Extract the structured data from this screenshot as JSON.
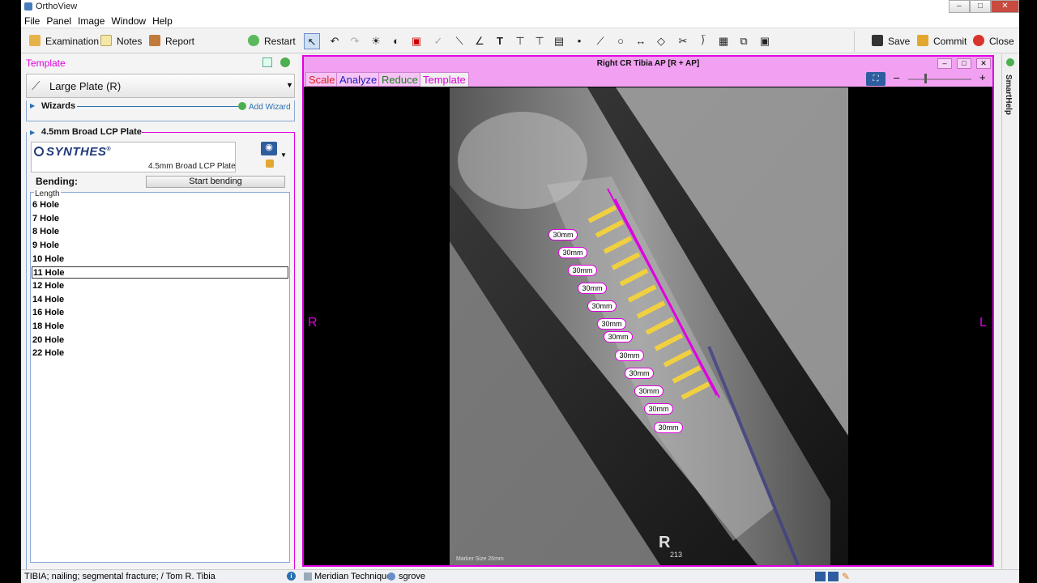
{
  "app_title": "OrthoView",
  "menu": [
    "File",
    "Panel",
    "Image",
    "Window",
    "Help"
  ],
  "toolbar": {
    "examination": "Examination",
    "notes": "Notes",
    "report": "Report",
    "restart": "Restart",
    "save": "Save",
    "commit": "Commit",
    "close": "Close"
  },
  "left_panel": {
    "header": "Template",
    "plate_selector": "Large Plate (R)",
    "wizards_label": "Wizards",
    "add_wizard": "Add Wizard",
    "plate_section": "4.5mm Broad LCP Plate",
    "brand": "SYNTHES",
    "brand_mark": "®",
    "plate_name": "4.5mm Broad LCP Plate",
    "bending_label": "Bending:",
    "start_bending": "Start bending",
    "length_label": "Length",
    "lengths": [
      "6 Hole",
      "7 Hole",
      "8 Hole",
      "9 Hole",
      "10 Hole",
      "11 Hole",
      "12 Hole",
      "14 Hole",
      "16 Hole",
      "18 Hole",
      "20 Hole",
      "22 Hole"
    ],
    "selected_length": "11 Hole"
  },
  "viewer": {
    "title": "Right CR Tibia AP [R + AP]",
    "tabs": [
      {
        "label": "Scale",
        "color": "#e02020"
      },
      {
        "label": "Analyze",
        "color": "#2020c0"
      },
      {
        "label": "Reduce",
        "color": "#208020"
      },
      {
        "label": "Template",
        "color": "#e000e0"
      }
    ],
    "active_tab": "Template",
    "left_marker": "R",
    "right_marker": "L",
    "screw_labels": [
      "30mm",
      "30mm",
      "30mm",
      "30mm",
      "30mm",
      "30mm",
      "30mm",
      "30mm",
      "30mm",
      "30mm",
      "30mm",
      "30mm"
    ],
    "marker_size": "Marker Size 26mm",
    "film_marker": "R",
    "film_marker_sub": "213"
  },
  "smarthelp": "SmartHelp",
  "status": {
    "case": "TIBIA; nailing; segmental fracture; / Tom R. Tibia",
    "technique": "Meridian Technique",
    "user": "sgrove"
  },
  "colors": {
    "accent": "#e000e0",
    "screw": "#f0d040",
    "viewer_header": "#f2a0f2"
  }
}
